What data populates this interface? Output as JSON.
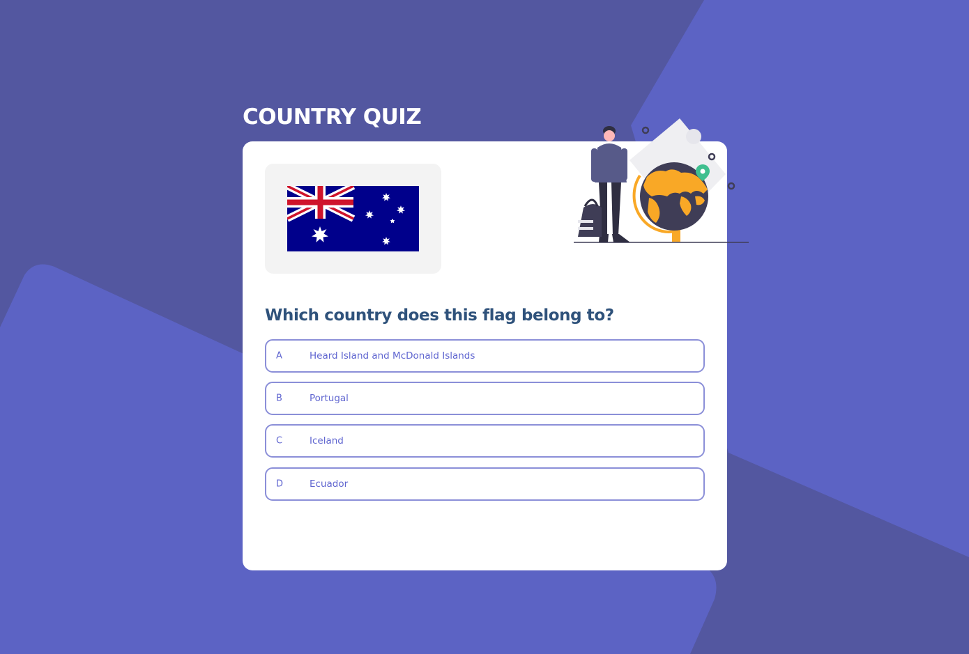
{
  "app": {
    "title": "COUNTRY QUIZ"
  },
  "colors": {
    "background_dark": "#5357a0",
    "background_light": "#5c63c4",
    "card": "#ffffff",
    "question_text": "#2f527b",
    "option_border": "#8b8fd8",
    "option_text": "#6066d0",
    "flag_panel": "#f3f3f3",
    "globe_land": "#f9a826"
  },
  "quiz": {
    "flag_icon": "australia-flag",
    "question": "Which country does this flag belong to?",
    "options": [
      {
        "letter": "A",
        "label": "Heard Island and McDonald Islands"
      },
      {
        "letter": "B",
        "label": "Portugal"
      },
      {
        "letter": "C",
        "label": "Iceland"
      },
      {
        "letter": "D",
        "label": "Ecuador"
      }
    ]
  },
  "illustration": {
    "icon": "traveler-with-globe-illustration"
  }
}
